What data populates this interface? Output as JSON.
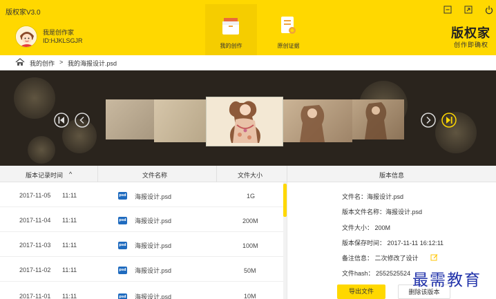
{
  "app": {
    "title": "版权家V3.0",
    "brand_logo": "版权家",
    "brand_slogan": "创作即确权"
  },
  "user": {
    "name": "我是创作家",
    "id": "ID:HJKLSGJR"
  },
  "nav": {
    "tabs": [
      {
        "label": "我的创作",
        "icon": "box-icon",
        "active": true
      },
      {
        "label": "原创证据",
        "icon": "certificate-icon",
        "active": false
      }
    ]
  },
  "window_controls": [
    "minimize-icon",
    "maximize-icon",
    "power-icon"
  ],
  "breadcrumb": {
    "items": [
      "我的创作",
      "我的海报设计.psd"
    ],
    "separator": ">"
  },
  "table": {
    "headers": {
      "time": "版本记录时间",
      "filename": "文件名称",
      "size": "文件大小"
    },
    "sort_indicator": "^",
    "rows": [
      {
        "date": "2017-11-05",
        "time": "11:11",
        "name": "海报设计.psd",
        "size": "1G"
      },
      {
        "date": "2017-11-04",
        "time": "11:11",
        "name": "海报设计.psd",
        "size": "200M"
      },
      {
        "date": "2017-11-03",
        "time": "11:11",
        "name": "海报设计.psd",
        "size": "100M"
      },
      {
        "date": "2017-11-02",
        "time": "11:11",
        "name": "海报设计.psd",
        "size": "50M"
      },
      {
        "date": "2017-11-01",
        "time": "11:11",
        "name": "海报设计.psd",
        "size": "10M"
      }
    ],
    "file_badge": "psd"
  },
  "version_info": {
    "header": "版本信息",
    "file_name": "文件名：海报设计.psd",
    "version_file_name": "版本文件名称：海报设计.psd",
    "file_size": "文件大小：  200M",
    "save_time": "版本保存时间：  2017-11-11  16:12:11",
    "remark": "备注信息：  二次修改了设计",
    "file_hash": "文件hash：  2552525524",
    "export_button": "导出文件",
    "delete_button": "删除该版本"
  },
  "watermark": "最需教育",
  "colors": {
    "accent": "#ffd800",
    "accent_dark": "#f5cd00",
    "file_icon": "#1f6bbf"
  }
}
